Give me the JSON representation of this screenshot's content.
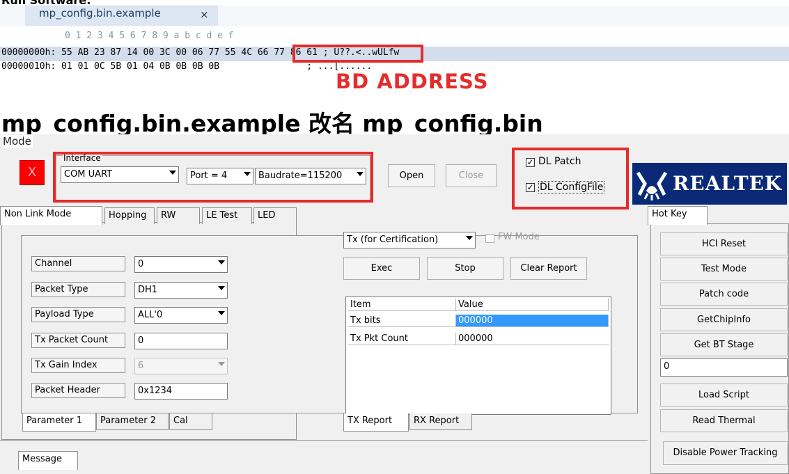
{
  "top_cut_text": "Run Software:",
  "file_tab": {
    "label": "mp_config.bin.example",
    "close": "×"
  },
  "hex": {
    "ruler": "0  1  2  3  4  5  6  7  8  9  a  b  c  d  e  f",
    "line1": "00000000h: 55 AB 23 87 14 00 3C 00 06 77 55 4C 66 77 86 61 ; U??.<..wULfw",
    "line2": "00000010h: 01 01 0C 5B 01 04 0B 0B 0B 0B                ; ...[......"
  },
  "annotation": {
    "bd_address": "BD ADDRESS",
    "caption": "mp_config.bin.example 改名 mp_config.bin",
    "color": "#e52c2c"
  },
  "mode": {
    "label": "Mode",
    "status_x": "X",
    "interface_legend": "Interface",
    "interface_value": "COM UART",
    "port_value": "Port = 4",
    "baud_value": "Baudrate=115200",
    "open_label": "Open",
    "close_label": "Close",
    "dl_patch_label": "DL Patch",
    "dl_patch_checked": true,
    "dl_config_label": "DL ConfigFile",
    "dl_config_checked": true,
    "check_mark": "✓",
    "logo_text": "REALTEK"
  },
  "tabs": [
    "Non Link Mode",
    "Hopping",
    "RW",
    "LE Test",
    "LED"
  ],
  "params": {
    "channel_label": "Channel",
    "channel_value": "0",
    "packet_type_label": "Packet Type",
    "packet_type_value": "DH1",
    "payload_type_label": "Payload Type",
    "payload_type_value": "ALL'0",
    "tx_packet_count_label": "Tx Packet Count",
    "tx_packet_count_value": "0",
    "tx_gain_index_label": "Tx Gain Index",
    "tx_gain_index_value": "6",
    "packet_header_label": "Packet Header",
    "packet_header_value": "0x1234"
  },
  "sub_tabs": [
    "Parameter 1",
    "Parameter 2",
    "Cal"
  ],
  "tx": {
    "mode_value": "Tx (for Certification)",
    "fw_mode_label": "FW Mode",
    "exec_label": "Exec",
    "stop_label": "Stop",
    "clear_label": "Clear Report",
    "table_headers": [
      "Item",
      "Value"
    ],
    "rows": [
      {
        "item": "Tx bits",
        "value": "000000"
      },
      {
        "item": "Tx Pkt Count",
        "value": "000000"
      }
    ],
    "report_tabs": [
      "TX Report",
      "RX Report"
    ]
  },
  "hotkey": {
    "tab_label": "Hot Key",
    "buttons": [
      "HCI Reset",
      "Test Mode",
      "Patch code",
      "GetChipInfo",
      "Get BT Stage"
    ],
    "stage_value": "0",
    "buttons2": [
      "Load Script",
      "Read Thermal",
      "Disable Power Tracking"
    ]
  },
  "message_tab": "Message"
}
